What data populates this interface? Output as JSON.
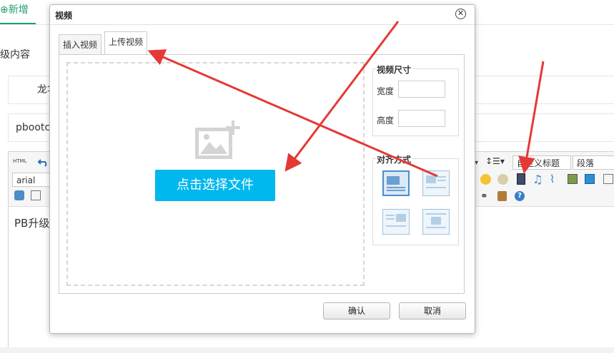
{
  "background": {
    "tab_label": "⊕新增",
    "section_label": "级内容",
    "field1_value": "龙华",
    "field2_value": "pbootcm",
    "toolbar": {
      "html_label": "HTML",
      "font_select": "arial",
      "heading_select": "自定义标题",
      "paragraph_select": "段落"
    },
    "content_text": "PB升级"
  },
  "dialog": {
    "title": "视频",
    "tabs": [
      {
        "label": "插入视频",
        "active": false
      },
      {
        "label": "上传视频",
        "active": true
      }
    ],
    "upload_button": "点击选择文件",
    "video_size": {
      "legend": "视频尺寸",
      "width_label": "宽度",
      "width_value": "",
      "height_label": "高度",
      "height_value": ""
    },
    "alignment": {
      "legend": "对齐方式",
      "options": [
        "none",
        "left",
        "right",
        "center"
      ],
      "selected": "none"
    },
    "confirm_label": "确认",
    "cancel_label": "取消"
  },
  "colors": {
    "accent": "#00b7ee",
    "annotation_arrow": "#e53935",
    "tab_green": "#1e9e6a"
  },
  "icons": [
    "image-placeholder-icon",
    "close-icon",
    "undo-icon",
    "smiley-icon",
    "video-icon",
    "music-icon",
    "attachment-icon",
    "image-icon",
    "map-icon",
    "help-icon"
  ]
}
